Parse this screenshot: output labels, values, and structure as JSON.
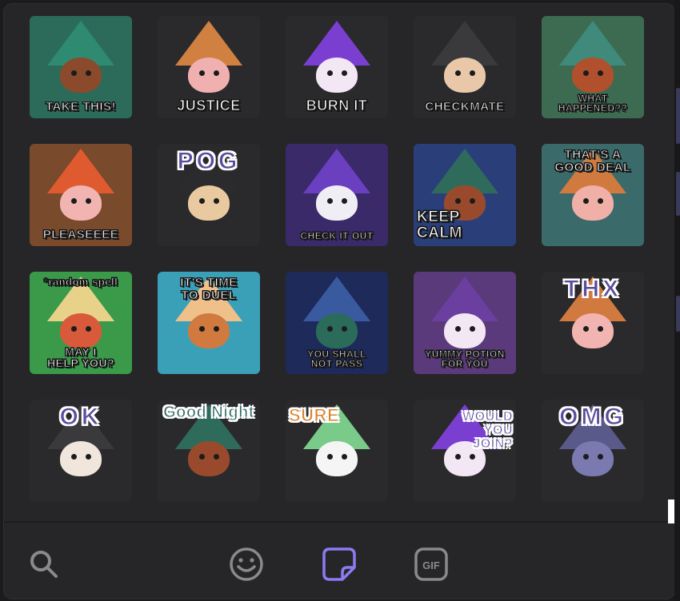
{
  "stickers": [
    {
      "caption": "TAKE THIS!",
      "bg": "#2c6b5a",
      "hat": "#2e8a70",
      "face": "#8b4a2c",
      "pos": "bottom"
    },
    {
      "caption": "JUSTICE",
      "bg": "#2a2a2c",
      "hat": "#d08040",
      "face": "#f0b0b0",
      "pos": "bottom"
    },
    {
      "caption": "BURN IT",
      "bg": "#2a2a2c",
      "hat": "#7a3fd0",
      "face": "#f3e6f5",
      "pos": "bottom"
    },
    {
      "caption": "CHECKMATE",
      "bg": "#2a2a2c",
      "hat": "#3a3a3c",
      "face": "#e8c8a8",
      "pos": "bottom"
    },
    {
      "caption": "WHAT\nHAPPENED??",
      "bg": "#3d6b52",
      "hat": "#3f8a7a",
      "face": "#b0502c",
      "pos": "bottom"
    },
    {
      "caption": "PLEASEEEE",
      "bg": "#7a4a2c",
      "hat": "#e05a30",
      "face": "#f2b4b0",
      "pos": "bottom"
    },
    {
      "caption": "POG",
      "bg": "#2a2a2c",
      "hat": "#2b2b2e",
      "face": "#e9c9a0",
      "pos": "top-purple"
    },
    {
      "caption": "CHECK IT OUT",
      "bg": "#3a2a6a",
      "hat": "#6a3fc0",
      "face": "#f0eef5",
      "pos": "bottom"
    },
    {
      "caption": "KEEP\nCALM",
      "bg": "#2a3f7a",
      "hat": "#2f6b5a",
      "face": "#9a4a2c",
      "pos": "bottom-left"
    },
    {
      "caption": "THAT'S A\nGOOD DEAL",
      "bg": "#3a6a6a",
      "hat": "#d07a40",
      "face": "#f0b0a8",
      "pos": "top"
    },
    {
      "caption": "*random spell",
      "caption2": "MAY I\nHELP YOU?",
      "bg": "#3a9a4a",
      "hat": "#e8d28a",
      "face": "#d85a3a",
      "pos": "both"
    },
    {
      "caption": "IT'S TIME\nTO DUEL",
      "bg": "#3aa0b8",
      "hat": "#f0c08a",
      "face": "#d07a40",
      "pos": "top"
    },
    {
      "caption": "YOU SHALL\nNOT PASS",
      "bg": "#1e2a5a",
      "hat": "#3a5aa0",
      "face": "#2a6b5a",
      "pos": "bottom"
    },
    {
      "caption": "YUMMY POTION\nFOR YOU",
      "bg": "#5a3a7a",
      "hat": "#6a3fa0",
      "face": "#f3e6f5",
      "pos": "bottom"
    },
    {
      "caption": "THX",
      "bg": "#2a2a2c",
      "hat": "#d07a40",
      "face": "#f2b4b0",
      "pos": "top-purple"
    },
    {
      "caption": "OK",
      "bg": "#2a2a2c",
      "hat": "#3a3a3c",
      "face": "#f0e6dc",
      "pos": "top-purple"
    },
    {
      "caption": "Good Night",
      "bg": "#2a2a2c",
      "hat": "#2f6b5a",
      "face": "#9a4a2c",
      "pos": "top-teal"
    },
    {
      "caption": "SURE",
      "bg": "#2a2a2c",
      "hat": "#7acb8a",
      "face": "#f5f5f5",
      "pos": "top-orange"
    },
    {
      "caption": "WOULD\nYOU\nJOIN?",
      "bg": "#2a2a2c",
      "hat": "#7a3fd0",
      "face": "#f3e6f5",
      "pos": "top-purple-right"
    },
    {
      "caption": "OMG",
      "bg": "#2a2a2c",
      "hat": "#5a5a8a",
      "face": "#7a7ab0",
      "pos": "top-purple"
    }
  ],
  "toolbar": {
    "items": [
      {
        "name": "search-icon",
        "active": false
      },
      {
        "name": "emoji-icon",
        "active": false
      },
      {
        "name": "sticker-icon",
        "active": true
      },
      {
        "name": "gif-icon",
        "active": false,
        "label": "GIF"
      }
    ],
    "accent": "#8b7cf6",
    "inactive": "#8a8a8e"
  }
}
